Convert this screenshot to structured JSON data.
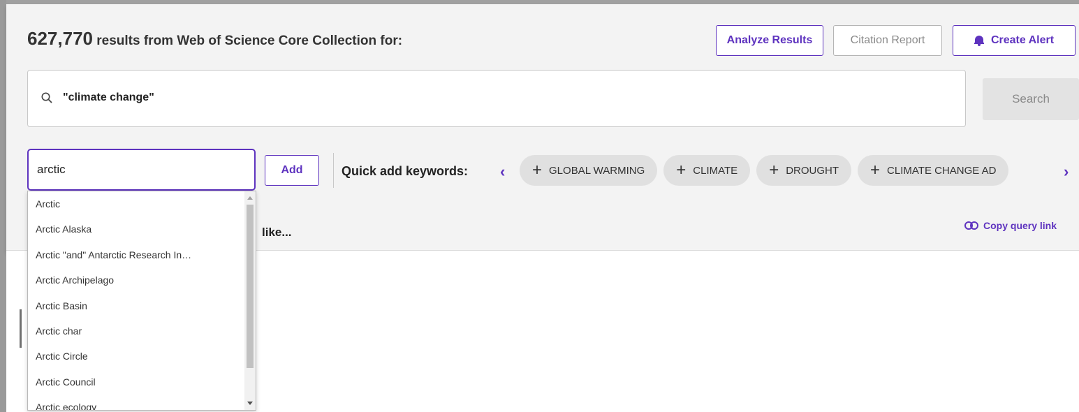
{
  "header": {
    "count": "627,770",
    "suffix": " results from Web of Science Core Collection for:",
    "analyze_label": "Analyze Results",
    "citation_label": "Citation Report",
    "alert_label": "Create Alert"
  },
  "search": {
    "query": "\"climate change\"",
    "button_label": "Search"
  },
  "refine": {
    "input_value": "arctic",
    "add_label": "Add",
    "quick_label": "Quick add keywords:",
    "chips": [
      "GLOBAL WARMING",
      "CLIMATE",
      "DROUGHT",
      "CLIMATE CHANGE AD"
    ],
    "suggest_visible": "like...",
    "copy_label": "Copy query link"
  },
  "dropdown": {
    "items": [
      "Arctic",
      "Arctic Alaska",
      "Arctic \"and\" Antarctic Research In…",
      "Arctic Archipelago",
      "Arctic Basin",
      "Arctic char",
      "Arctic Circle",
      "Arctic Council",
      "Arctic ecology"
    ]
  },
  "colors": {
    "accent": "#5e33bf",
    "panel": "#f3f3f3"
  }
}
